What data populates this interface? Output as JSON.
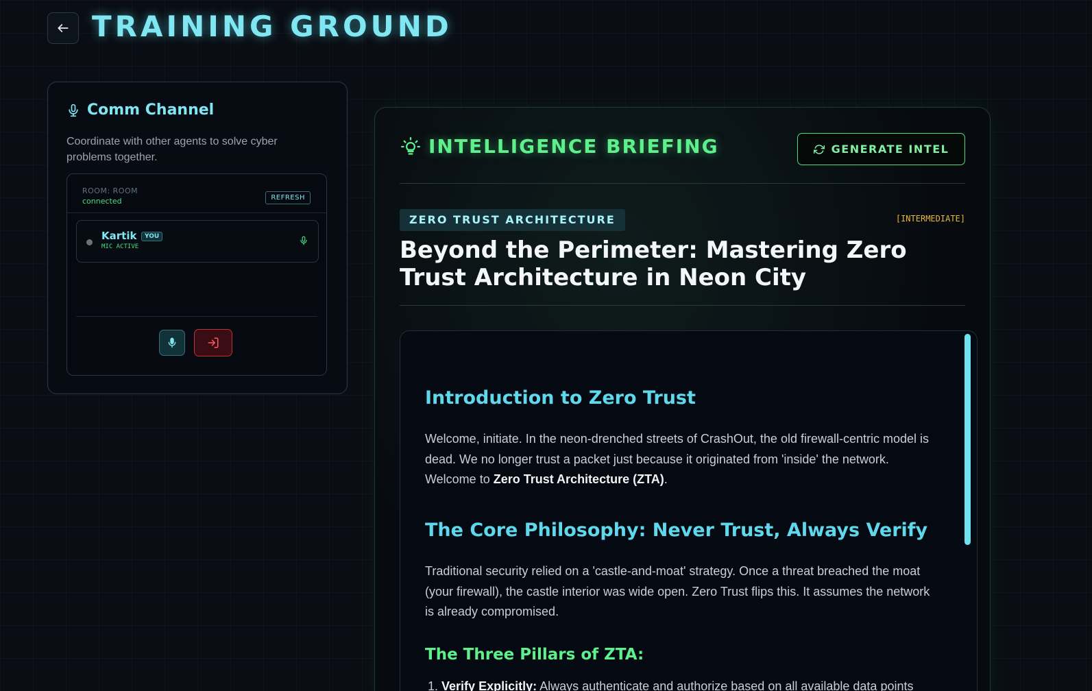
{
  "header": {
    "title": "TRAINING GROUND",
    "back_icon": "arrow-left-icon"
  },
  "comm": {
    "title": "Comm Channel",
    "description": "Coordinate with other agents to solve cyber problems together.",
    "room_label": "ROOM: ROOM",
    "room_status": "connected",
    "refresh_label": "REFRESH",
    "participant": {
      "name": "Kartik",
      "badge": "YOU",
      "mic_status": "MIC ACTIVE"
    }
  },
  "briefing": {
    "title": "INTELLIGENCE BRIEFING",
    "generate_label": "GENERATE INTEL",
    "topic": "ZERO TRUST ARCHITECTURE",
    "level": "[INTERMEDIATE]",
    "article_title": "Beyond the Perimeter: Mastering Zero Trust Architecture in Neon City",
    "sections": {
      "intro_heading": "Introduction to Zero Trust",
      "intro_text": "Welcome, initiate. In the neon-drenched streets of CrashOut, the old firewall-centric model is dead. We no longer trust a packet just because it originated from 'inside' the network. Welcome to ",
      "intro_bold": "Zero Trust Architecture (ZTA)",
      "intro_end": ".",
      "core_heading": "The Core Philosophy: Never Trust, Always Verify",
      "core_text": "Traditional security relied on a 'castle-and-moat' strategy. Once a threat breached the moat (your firewall), the castle interior was wide open. Zero Trust flips this. It assumes the network is already compromised.",
      "pillars_heading": "The Three Pillars of ZTA:",
      "pillar1_num": "1.",
      "pillar1_bold": "Verify Explicitly:",
      "pillar1_text": " Always authenticate and authorize based on all available data points"
    }
  },
  "colors": {
    "cyan": "#7fe6f2",
    "green": "#4ade80",
    "amber": "#e8b93a",
    "danger": "#c0303a",
    "background": "#0a0e14"
  }
}
